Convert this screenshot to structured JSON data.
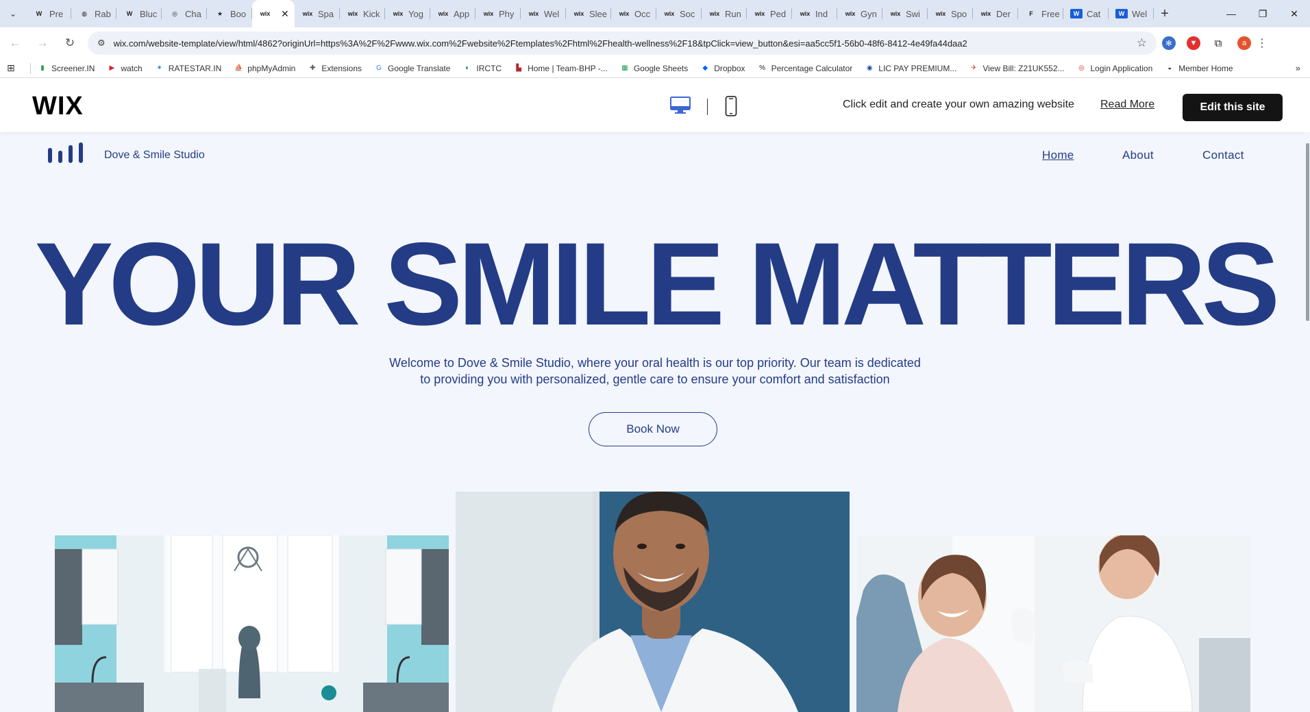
{
  "browser": {
    "tabs": [
      {
        "fav": "W",
        "title": "Pre",
        "blue": false
      },
      {
        "fav": "◍",
        "title": "Rab",
        "blue": false
      },
      {
        "fav": "W",
        "title": "Bluc",
        "blue": false
      },
      {
        "fav": "◎",
        "title": "Cha",
        "blue": false
      },
      {
        "fav": "★",
        "title": "Boo",
        "blue": false
      },
      {
        "fav": "wix",
        "title": "",
        "blue": false,
        "active": true
      },
      {
        "fav": "wix",
        "title": "Spa",
        "blue": false
      },
      {
        "fav": "wix",
        "title": "Kick",
        "blue": false
      },
      {
        "fav": "wix",
        "title": "Yog",
        "blue": false
      },
      {
        "fav": "wix",
        "title": "App",
        "blue": false
      },
      {
        "fav": "wix",
        "title": "Phy",
        "blue": false
      },
      {
        "fav": "wix",
        "title": "Wel",
        "blue": false
      },
      {
        "fav": "wix",
        "title": "Slee",
        "blue": false
      },
      {
        "fav": "wix",
        "title": "Occ",
        "blue": false
      },
      {
        "fav": "wix",
        "title": "Soc",
        "blue": false
      },
      {
        "fav": "wix",
        "title": "Run",
        "blue": false
      },
      {
        "fav": "wix",
        "title": "Ped",
        "blue": false
      },
      {
        "fav": "wix",
        "title": "Ind",
        "blue": false
      },
      {
        "fav": "wix",
        "title": "Gyn",
        "blue": false
      },
      {
        "fav": "wix",
        "title": "Swi",
        "blue": false
      },
      {
        "fav": "wix",
        "title": "Spo",
        "blue": false
      },
      {
        "fav": "wix",
        "title": "Der",
        "blue": false
      },
      {
        "fav": "F",
        "title": "Free",
        "blue": false
      },
      {
        "fav": "W",
        "title": "Cat",
        "blue": true
      },
      {
        "fav": "W",
        "title": "Wel",
        "blue": true
      }
    ],
    "active_tab_close": "✕",
    "new_tab": "+",
    "window_controls": [
      "—",
      "❐",
      "✕"
    ],
    "url": "wix.com/website-template/view/html/4862?originUrl=https%3A%2F%2Fwww.wix.com%2Fwebsite%2Ftemplates%2Fhtml%2Fhealth-wellness%2F18&tpClick=view_button&esi=aa5cc5f1-56b0-48f6-8412-4e49fa44daa2",
    "avatar_letter": "a",
    "bookmarks": [
      {
        "label": "Screener.IN",
        "icon": "▮",
        "color": "#2e9d4b"
      },
      {
        "label": "watch",
        "icon": "▶",
        "color": "#e02020"
      },
      {
        "label": "RATESTAR.IN",
        "icon": "✶",
        "color": "#2b6fd6"
      },
      {
        "label": "phpMyAdmin",
        "icon": "⛵",
        "color": "#e08a1e"
      },
      {
        "label": "Extensions",
        "icon": "✚",
        "color": "#555555"
      },
      {
        "label": "Google Translate",
        "icon": "G",
        "color": "#3a78f2"
      },
      {
        "label": "IRCTC",
        "icon": "◐",
        "color": "#1d4fa0"
      },
      {
        "label": "Home | Team-BHP -...",
        "icon": "▙",
        "color": "#b3282d"
      },
      {
        "label": "Google Sheets",
        "icon": "▦",
        "color": "#1e9e57"
      },
      {
        "label": "Dropbox",
        "icon": "◆",
        "color": "#0061fe"
      },
      {
        "label": "Percentage Calculator",
        "icon": "%",
        "color": "#222222"
      },
      {
        "label": "LIC PAY PREMIUM...",
        "icon": "◉",
        "color": "#1b4fa3"
      },
      {
        "label": "View Bill: Z21UK552...",
        "icon": "✈",
        "color": "#d94a2a"
      },
      {
        "label": "Login Application",
        "icon": "◎",
        "color": "#c0392b"
      },
      {
        "label": "Member Home",
        "icon": "◒",
        "color": "#333333"
      }
    ],
    "bookmarks_more": "»"
  },
  "wix_banner": {
    "logo": "WIX",
    "message": "Click edit and create your own amazing website",
    "read_more": "Read More",
    "edit_button": "Edit this site"
  },
  "site": {
    "name": "Dove & Smile Studio",
    "nav": {
      "home": "Home",
      "about": "About",
      "contact": "Contact"
    },
    "hero_title": "YOUR SMILE MATTERS",
    "hero_subtitle_line1": "Welcome to Dove & Smile Studio, where your oral health is our top priority. Our team is dedicated",
    "hero_subtitle_line2": "to providing you with personalized, gentle care to ensure your comfort and satisfaction",
    "book_button": "Book Now",
    "colors": {
      "brand": "#243c85",
      "background": "#f3f6fd"
    }
  }
}
